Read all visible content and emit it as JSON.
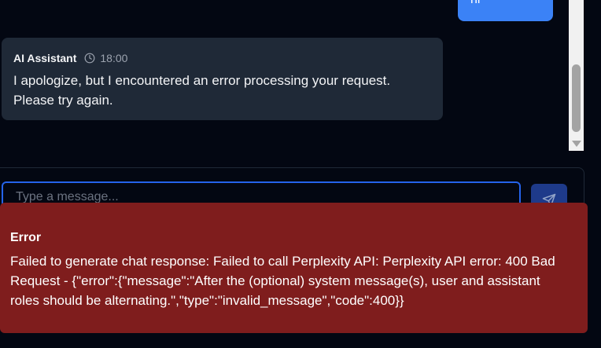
{
  "messages": {
    "user": {
      "text": "hi"
    },
    "assistant": {
      "name": "AI Assistant",
      "time": "18:00",
      "text": "I apologize, but I encountered an error processing your request. Please try again."
    }
  },
  "composer": {
    "placeholder": "Type a message...",
    "value": "",
    "send_icon": "send-icon"
  },
  "error": {
    "title": "Error",
    "message": "Failed to generate chat response: Failed to call Perplexity API: Perplexity API error: 400 Bad Request - {\"error\":{\"message\":\"After the (optional) system message(s), user and assistant roles should be alternating.\",\"type\":\"invalid_message\",\"code\":400}}"
  },
  "colors": {
    "background": "#030712",
    "user_bubble": "#3b82f6",
    "assistant_bubble": "#1f2937",
    "error_bg": "#7f1d1d",
    "focus_ring": "#2563eb"
  }
}
